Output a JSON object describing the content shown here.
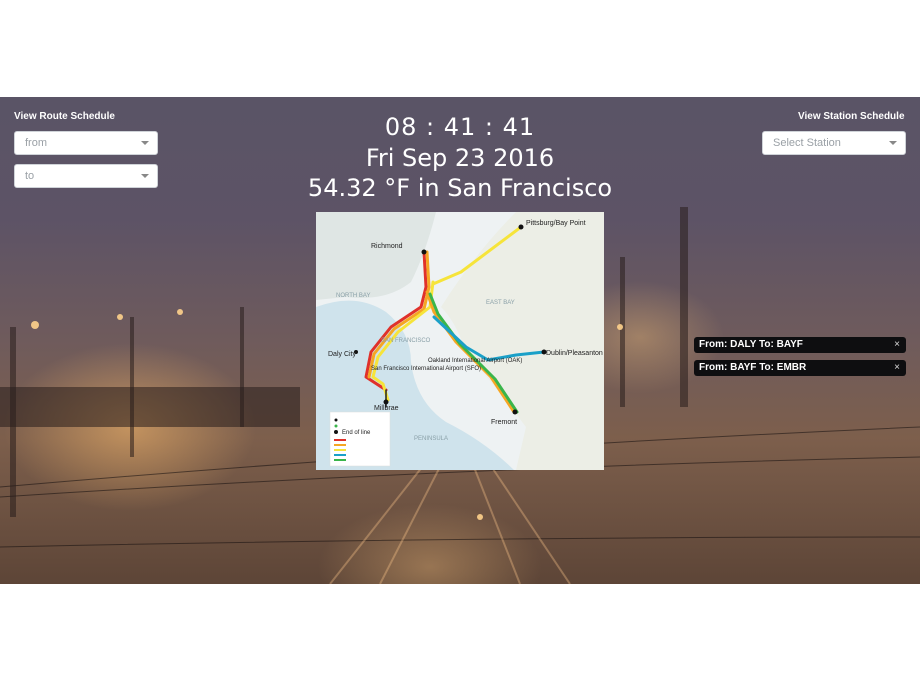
{
  "route_schedule": {
    "title": "View Route Schedule",
    "from_placeholder": "from",
    "to_placeholder": "to"
  },
  "station_schedule": {
    "title": "View Station Schedule",
    "placeholder": "Select Station"
  },
  "header": {
    "time": "08 : 41 : 41",
    "date": "Fri Sep 23 2016",
    "weather": "54.32 °F in San Francisco"
  },
  "map": {
    "labels": {
      "richmond": "Richmond",
      "pittsburg": "Pittsburg/Bay Point",
      "north_bay": "NORTH BAY",
      "east_bay": "EAST BAY",
      "san_francisco": "SAN FRANCISCO",
      "daly_city": "Daly City",
      "sfo": "San Francisco International Airport (SFO)",
      "oak": "Oakland International Airport (OAK)",
      "dublin": "Dublin/Pleasanton",
      "millbrae": "Millbrae",
      "fremont": "Fremont",
      "peninsula": "PENINSULA"
    },
    "legend": {
      "end_of_line": "End of line"
    },
    "line_colors": {
      "red": "#e0312a",
      "orange": "#f5a623",
      "yellow": "#f6e43a",
      "blue": "#1aa0c8",
      "green": "#3ab54a",
      "black": "#222222"
    }
  },
  "saved_routes": [
    {
      "label": "From: DALY To: BAYF",
      "close": "×"
    },
    {
      "label": "From: BAYF To: EMBR",
      "close": "×"
    }
  ]
}
